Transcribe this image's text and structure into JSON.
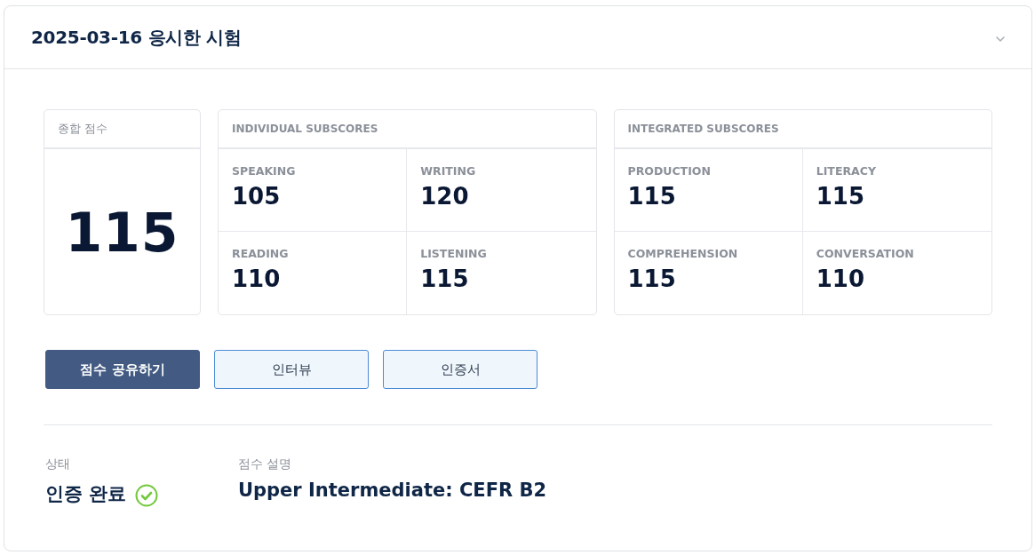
{
  "header": {
    "title": "2025-03-16 응시한 시험",
    "expanded": true
  },
  "total_score": {
    "label": "종합 점수",
    "value": "115"
  },
  "subscore_groups": [
    {
      "title": "INDIVIDUAL SUBSCORES",
      "items": [
        {
          "label": "SPEAKING",
          "value": "105"
        },
        {
          "label": "WRITING",
          "value": "120"
        },
        {
          "label": "READING",
          "value": "110"
        },
        {
          "label": "LISTENING",
          "value": "115"
        }
      ]
    },
    {
      "title": "INTEGRATED SUBSCORES",
      "items": [
        {
          "label": "PRODUCTION",
          "value": "115"
        },
        {
          "label": "LITERACY",
          "value": "115"
        },
        {
          "label": "COMPREHENSION",
          "value": "115"
        },
        {
          "label": "CONVERSATION",
          "value": "110"
        }
      ]
    }
  ],
  "buttons": [
    {
      "label": "점수 공유하기",
      "kind": "primary"
    },
    {
      "label": "인터뷰",
      "kind": "secondary"
    },
    {
      "label": "인증서",
      "kind": "secondary"
    }
  ],
  "details": [
    {
      "label": "상태",
      "value": "인증 완료",
      "verified": true
    },
    {
      "label": "점수 설명",
      "value": "Upper Intermediate: CEFR B2"
    }
  ]
}
